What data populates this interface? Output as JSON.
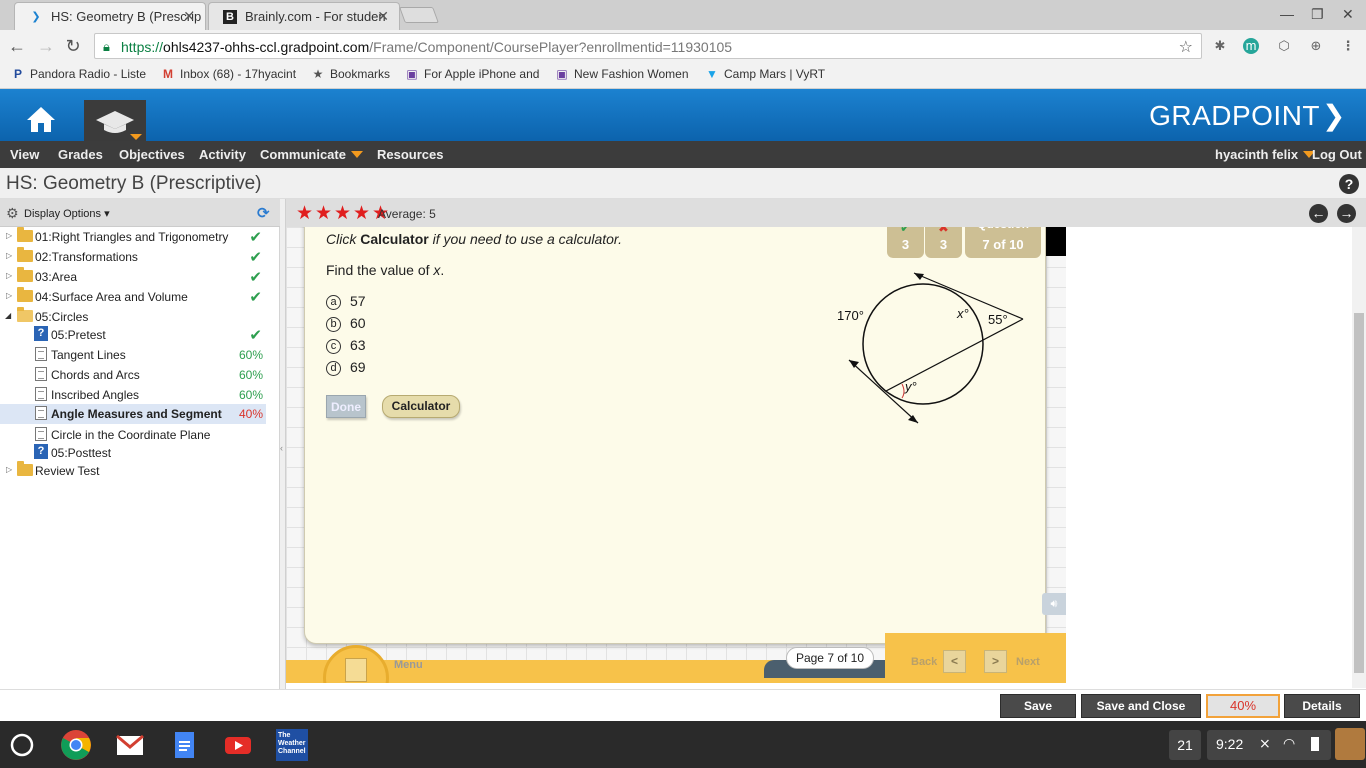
{
  "browser": {
    "tabs": [
      {
        "title": "HS: Geometry B (Prescrip",
        "active": true
      },
      {
        "title": "Brainly.com - For studen",
        "active": false
      }
    ],
    "url_prefix": "https://",
    "url_host": "ohls4237-ohhs-ccl.gradpoint.com",
    "url_path": "/Frame/Component/CoursePlayer?enrollmentid=11930105",
    "bookmarks": [
      {
        "label": "Pandora Radio - Liste",
        "icon": "pandora-icon"
      },
      {
        "label": "Inbox (68) - 17hyacint",
        "icon": "gmail-icon"
      },
      {
        "label": "Bookmarks",
        "icon": "star-icon"
      },
      {
        "label": "For Apple iPhone and",
        "icon": "shop-icon"
      },
      {
        "label": "New Fashion Women",
        "icon": "shop-icon"
      },
      {
        "label": "Camp Mars | VyRT",
        "icon": "vyrt-icon"
      }
    ]
  },
  "app": {
    "logo": "GRADPOINT",
    "menu": [
      "View",
      "Grades",
      "Objectives",
      "Activity",
      "Communicate",
      "Resources"
    ],
    "user": "hyacinth felix",
    "logout": "Log Out",
    "page_title": "HS: Geometry B (Prescriptive)"
  },
  "sidebar": {
    "display_options": "Display Options",
    "items": [
      {
        "label": "01:Right Triangles and Trigonometry",
        "type": "folder",
        "status": "check"
      },
      {
        "label": "02:Transformations",
        "type": "folder",
        "status": "check"
      },
      {
        "label": "03:Area",
        "type": "folder",
        "status": "check"
      },
      {
        "label": "04:Surface Area and Volume",
        "type": "folder",
        "status": "check"
      },
      {
        "label": "05:Circles",
        "type": "folder-open",
        "status": ""
      },
      {
        "label": "05:Pretest",
        "type": "quiz",
        "status": "check"
      },
      {
        "label": "Tangent Lines",
        "type": "doc",
        "status": "60%"
      },
      {
        "label": "Chords and Arcs",
        "type": "doc",
        "status": "60%"
      },
      {
        "label": "Inscribed Angles",
        "type": "doc",
        "status": "60%"
      },
      {
        "label": "Angle Measures and Segment",
        "type": "doc",
        "status": "40%"
      },
      {
        "label": "Circle in the Coordinate Plane",
        "type": "doc",
        "status": ""
      },
      {
        "label": "05:Posttest",
        "type": "quiz",
        "status": ""
      },
      {
        "label": "Review Test",
        "type": "folder",
        "status": ""
      }
    ]
  },
  "rating": {
    "stars": 5,
    "average_label": "Average: 5"
  },
  "question": {
    "instruction_pre": "Click ",
    "instruction_bold": "Calculator",
    "instruction_post": " if you need to use a calculator.",
    "prompt_pre": "Find the value of ",
    "prompt_var": "x",
    "prompt_post": ".",
    "choices": [
      {
        "letter": "a",
        "value": "57"
      },
      {
        "letter": "b",
        "value": "60"
      },
      {
        "letter": "c",
        "value": "63"
      },
      {
        "letter": "d",
        "value": "69"
      }
    ],
    "done_label": "Done",
    "calculator_label": "Calculator",
    "correct_count": "3",
    "incorrect_count": "3",
    "question_label": "Question",
    "question_progress": "7 of 10",
    "figure": {
      "arc_label": "170°",
      "x_label": "x°",
      "angle_label": "55°",
      "y_label": "y°"
    }
  },
  "player_nav": {
    "menu_label": "Menu",
    "page_label": "Page",
    "page_progress": "7 of 10",
    "back_label": "Back",
    "next_label": "Next"
  },
  "actions": {
    "save": "Save",
    "save_close": "Save and Close",
    "percent": "40%",
    "details": "Details"
  },
  "shelf": {
    "apps": [
      "launcher-icon",
      "chrome-icon",
      "gmail-icon",
      "docs-icon",
      "youtube-icon",
      "weather-channel-icon"
    ],
    "weather_text": "The Weather Channel",
    "notification_count": "21",
    "time": "9:22"
  }
}
